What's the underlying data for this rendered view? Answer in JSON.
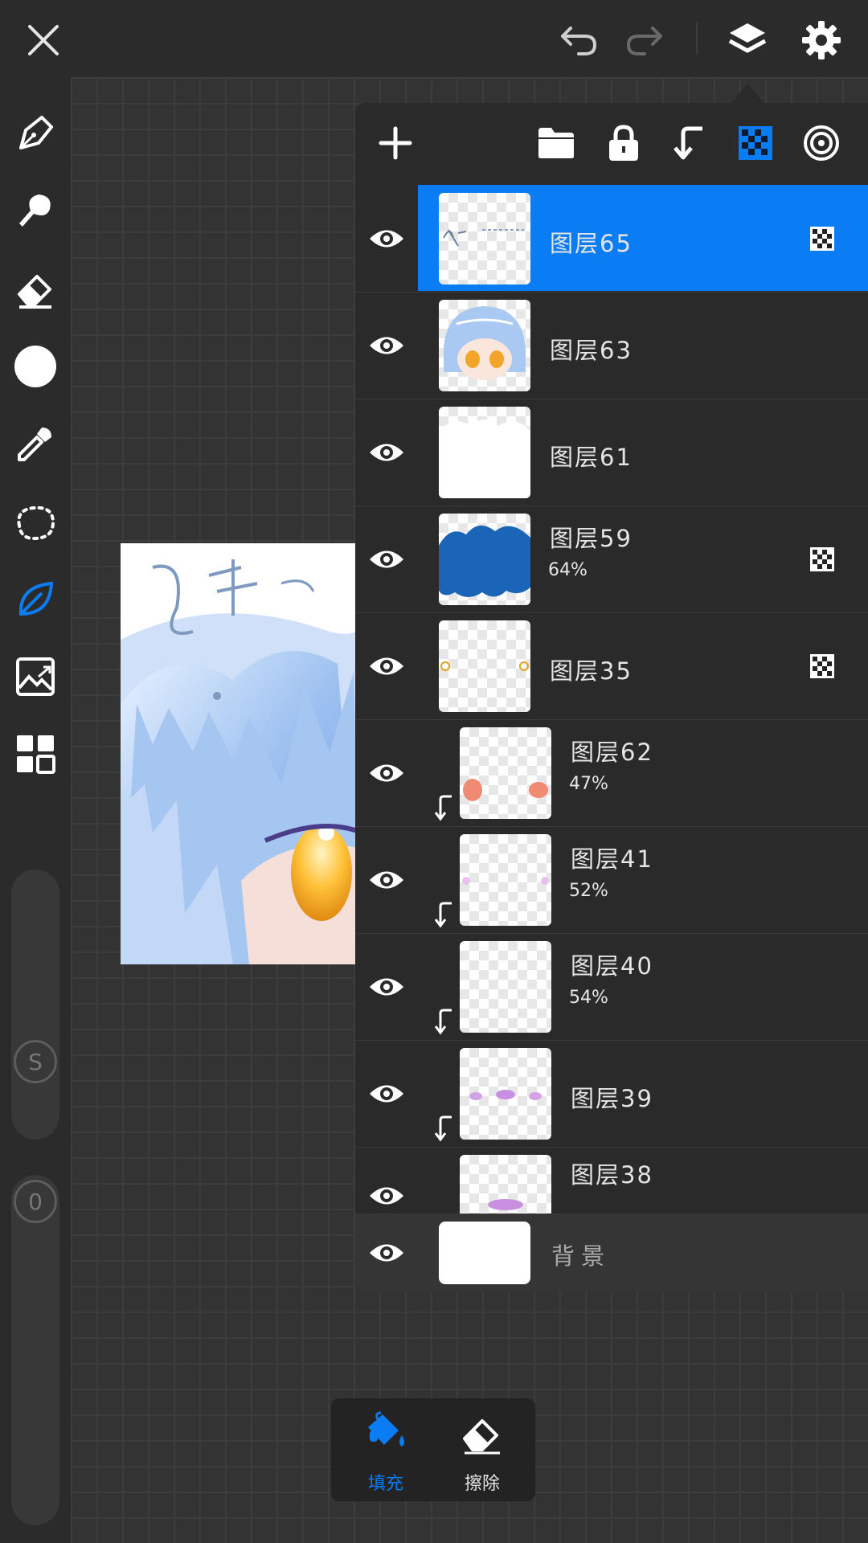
{
  "colors": {
    "accent": "#0a7cf4",
    "background": "#2b2b2b",
    "panel": "#2a2a2a"
  },
  "toolbar_left": {
    "icons": [
      "pen-icon",
      "smudge-icon",
      "eraser-icon",
      "color-swatch",
      "eyedropper-icon",
      "lasso-icon",
      "leaf-icon",
      "image-import-icon",
      "grid-menu-icon"
    ],
    "stabilizer_label": "S",
    "opacity_label": "0"
  },
  "layers_panel": {
    "tools": [
      "add-layer-icon",
      "folder-icon",
      "lock-icon",
      "clip-icon",
      "alpha-lock-icon",
      "blend-mode-icon"
    ],
    "layers": [
      {
        "name": "图层65",
        "opacity": "",
        "alpha_locked": true,
        "selected": true,
        "clipped": false
      },
      {
        "name": "图层63",
        "opacity": "",
        "alpha_locked": false,
        "selected": false,
        "clipped": false
      },
      {
        "name": "图层61",
        "opacity": "",
        "alpha_locked": false,
        "selected": false,
        "clipped": false
      },
      {
        "name": "图层59",
        "opacity": "64%",
        "alpha_locked": true,
        "selected": false,
        "clipped": false
      },
      {
        "name": "图层35",
        "opacity": "",
        "alpha_locked": true,
        "selected": false,
        "clipped": false
      },
      {
        "name": "图层62",
        "opacity": "47%",
        "alpha_locked": false,
        "selected": false,
        "clipped": true
      },
      {
        "name": "图层41",
        "opacity": "52%",
        "alpha_locked": false,
        "selected": false,
        "clipped": true
      },
      {
        "name": "图层40",
        "opacity": "54%",
        "alpha_locked": false,
        "selected": false,
        "clipped": true
      },
      {
        "name": "图层39",
        "opacity": "",
        "alpha_locked": false,
        "selected": false,
        "clipped": true
      },
      {
        "name": "图层38",
        "opacity": "",
        "alpha_locked": false,
        "selected": false,
        "clipped": false
      }
    ],
    "background_layer": "背景"
  },
  "bottom_popup": {
    "fill_label": "填充",
    "erase_label": "擦除"
  }
}
